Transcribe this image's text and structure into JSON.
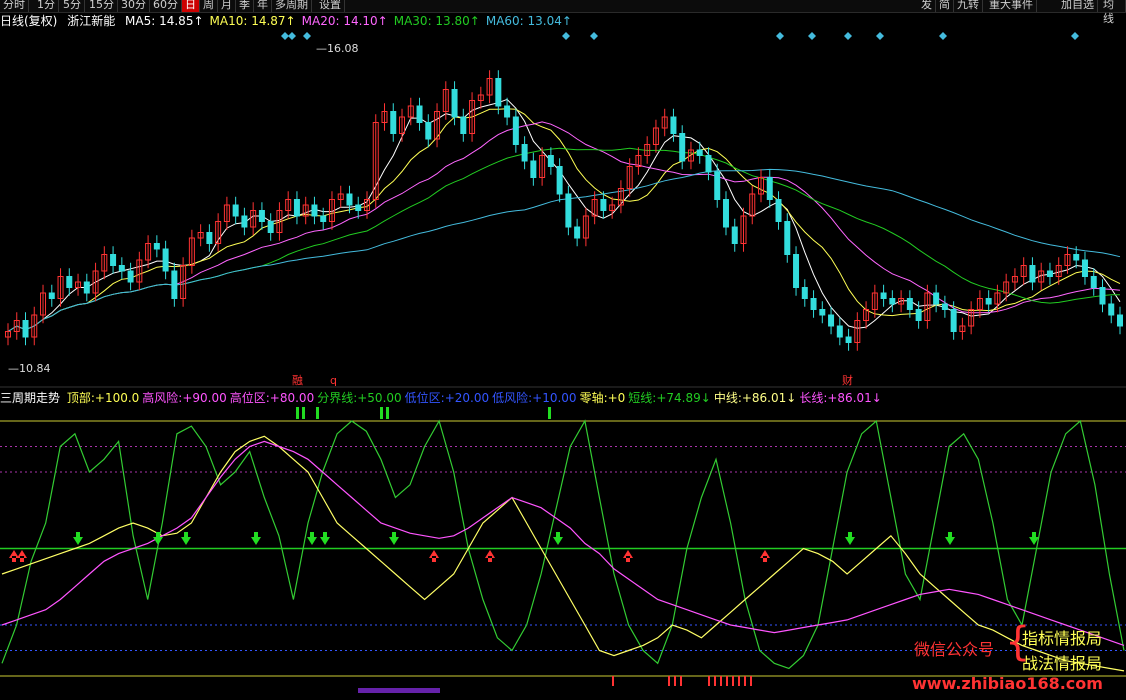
{
  "toolbar": {
    "tabs": [
      "分时",
      "1分",
      "5分",
      "15分",
      "30分",
      "60分",
      "日",
      "周",
      "月",
      "季",
      "年",
      "多周期",
      "设置"
    ],
    "active_tab": "日",
    "right_buttons": [
      "发",
      "简",
      "九转",
      "重大事件",
      "加自选",
      "均线"
    ]
  },
  "main_header": {
    "period": "日线(复权)",
    "stock_name": "浙江新能",
    "ma": [
      {
        "label": "MA5:",
        "value": "14.85↑",
        "color": "#ffffff"
      },
      {
        "label": "MA10:",
        "value": "14.87↑",
        "color": "#ffff55"
      },
      {
        "label": "MA20:",
        "value": "14.10↑",
        "color": "#ff66ff"
      },
      {
        "label": "MA30:",
        "value": "13.80↑",
        "color": "#22cc22"
      },
      {
        "label": "MA60:",
        "value": "13.04↑",
        "color": "#44bbdd"
      }
    ]
  },
  "price_labels": {
    "high": "16.08",
    "low": "10.84"
  },
  "event_labels": [
    {
      "text": "融",
      "color": "#ff3333"
    },
    {
      "text": "q",
      "color": "#ff3333"
    },
    {
      "text": "财",
      "color": "#ff3333"
    }
  ],
  "indicator_header": {
    "name": "三周期走势",
    "items": [
      {
        "label": "顶部:",
        "value": "+100.0",
        "color": "#ffff55"
      },
      {
        "label": "高风险:",
        "value": "+90.00",
        "color": "#ff55ff"
      },
      {
        "label": "高位区:",
        "value": "+80.00",
        "color": "#ff55ff"
      },
      {
        "label": "分界线:",
        "value": "+50.00",
        "color": "#22cc22"
      },
      {
        "label": "低位区:",
        "value": "+20.00",
        "color": "#3355ff"
      },
      {
        "label": "低风险:",
        "value": "+10.00",
        "color": "#3355ff"
      },
      {
        "label": "零轴:",
        "value": "+0",
        "color": "#ffff55"
      },
      {
        "label": "短线:",
        "value": "+74.89↓",
        "color": "#22cc22"
      },
      {
        "label": "中线:",
        "value": "+86.01↓",
        "color": "#ffff88"
      },
      {
        "label": "长线:",
        "value": "+86.01↓",
        "color": "#ff55ff"
      }
    ]
  },
  "watermark": {
    "wechat": "微信公众号",
    "line1": "指标情报局",
    "line2": "战法情报局",
    "url": "www.zhibiao168.com"
  },
  "chart_data": [
    {
      "type": "candlestick",
      "series_colors": {
        "up": "#ff3333",
        "down": "#33dddd"
      },
      "ylim": [
        10.5,
        16.5
      ],
      "high_mark": 16.08,
      "low_mark": 10.84,
      "close": [
        11.2,
        11.4,
        11.1,
        11.5,
        11.9,
        11.8,
        12.2,
        12.0,
        12.1,
        11.9,
        12.3,
        12.6,
        12.4,
        12.3,
        12.1,
        12.5,
        12.8,
        12.7,
        12.3,
        11.8,
        12.4,
        12.9,
        13.0,
        12.8,
        13.2,
        13.5,
        13.3,
        13.1,
        13.4,
        13.2,
        13.0,
        13.4,
        13.6,
        13.3,
        13.5,
        13.3,
        13.2,
        13.6,
        13.7,
        13.5,
        13.4,
        13.6,
        15.0,
        15.2,
        14.8,
        15.1,
        15.3,
        15.0,
        14.7,
        15.2,
        15.6,
        15.1,
        14.8,
        15.4,
        15.5,
        15.8,
        15.3,
        15.1,
        14.6,
        14.3,
        14.0,
        14.4,
        14.2,
        13.7,
        13.1,
        12.9,
        13.3,
        13.6,
        13.4,
        13.5,
        13.8,
        14.2,
        14.4,
        14.6,
        14.9,
        15.1,
        14.8,
        14.3,
        14.5,
        14.4,
        14.1,
        13.6,
        13.1,
        12.8,
        13.3,
        13.7,
        14.0,
        13.6,
        13.2,
        12.6,
        12.0,
        11.8,
        11.6,
        11.5,
        11.3,
        11.1,
        11.0,
        11.4,
        11.6,
        11.9,
        11.8,
        11.7,
        11.8,
        11.6,
        11.4,
        11.9,
        11.7,
        11.6,
        11.2,
        11.3,
        11.6,
        11.8,
        11.7,
        11.9,
        12.1,
        12.2,
        12.4,
        12.1,
        12.3,
        12.2,
        12.4,
        12.6,
        12.5,
        12.2,
        12.0,
        11.7,
        11.5,
        11.3
      ]
    },
    {
      "type": "line",
      "name": "三周期走势",
      "ylim": [
        0,
        100
      ],
      "levels": [
        100,
        50,
        0
      ],
      "series": [
        {
          "name": "短线",
          "color": "#33cc33",
          "values": [
            5,
            20,
            45,
            60,
            90,
            95,
            80,
            85,
            92,
            55,
            30,
            60,
            95,
            98,
            90,
            75,
            80,
            88,
            70,
            55,
            30,
            60,
            80,
            95,
            100,
            96,
            85,
            70,
            75,
            90,
            100,
            80,
            50,
            30,
            15,
            10,
            20,
            40,
            65,
            90,
            100,
            70,
            40,
            20,
            10,
            5,
            20,
            50,
            70,
            85,
            60,
            30,
            10,
            5,
            3,
            8,
            20,
            50,
            80,
            95,
            100,
            70,
            40,
            30,
            60,
            90,
            95,
            85,
            60,
            30,
            20,
            50,
            80,
            95,
            100,
            75,
            40,
            10
          ]
        },
        {
          "name": "中线",
          "color": "#ffff66",
          "values": [
            40,
            42,
            44,
            46,
            48,
            50,
            52,
            55,
            58,
            60,
            58,
            55,
            56,
            60,
            70,
            80,
            88,
            92,
            94,
            90,
            85,
            80,
            70,
            60,
            55,
            50,
            45,
            40,
            35,
            30,
            35,
            40,
            50,
            60,
            65,
            70,
            60,
            50,
            40,
            30,
            20,
            10,
            8,
            10,
            12,
            15,
            20,
            18,
            15,
            20,
            25,
            30,
            35,
            40,
            45,
            50,
            48,
            45,
            40,
            45,
            50,
            55,
            48,
            40,
            35,
            30,
            25,
            20,
            18,
            15,
            12,
            10,
            8,
            6,
            5,
            4,
            3,
            2
          ]
        },
        {
          "name": "长线",
          "color": "#ff55ff",
          "values": [
            20,
            22,
            24,
            26,
            30,
            35,
            40,
            45,
            48,
            50,
            52,
            55,
            58,
            62,
            70,
            78,
            85,
            90,
            92,
            90,
            88,
            85,
            80,
            75,
            70,
            65,
            60,
            58,
            56,
            55,
            54,
            55,
            58,
            62,
            66,
            70,
            68,
            66,
            62,
            58,
            52,
            48,
            42,
            38,
            34,
            30,
            28,
            26,
            24,
            22,
            20,
            19,
            18,
            17,
            18,
            19,
            20,
            21,
            22,
            24,
            26,
            28,
            30,
            32,
            33,
            34,
            33,
            32,
            30,
            28,
            26,
            24,
            22,
            20,
            18,
            16,
            14,
            12
          ]
        }
      ]
    }
  ]
}
